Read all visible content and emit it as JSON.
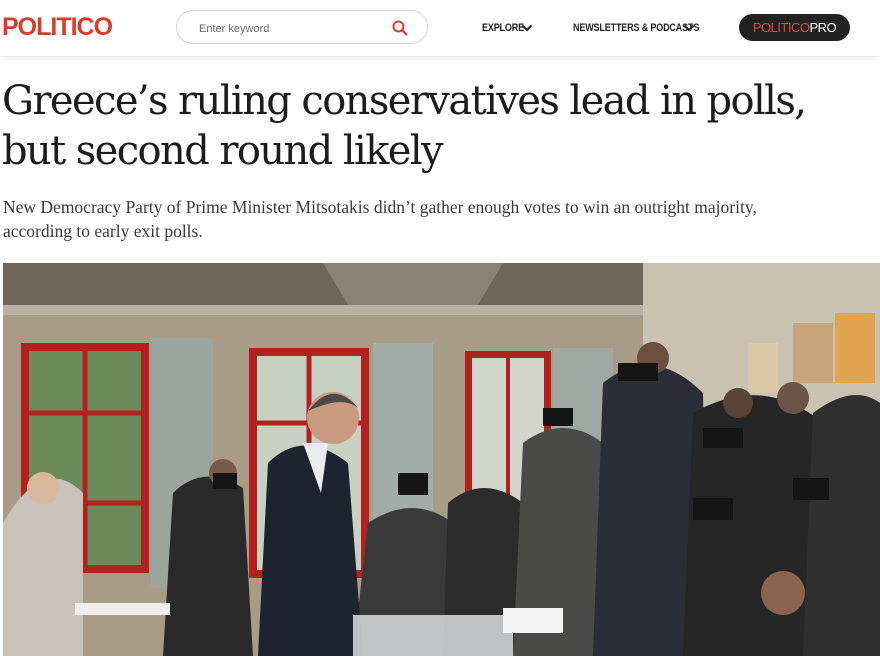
{
  "header": {
    "logo": "POLITICO",
    "search_placeholder": "Enter keyword",
    "nav": [
      {
        "label": "EXPLORE"
      },
      {
        "label": "NEWSLETTERS & PODCASTS"
      }
    ],
    "pro_button": {
      "part1": "POLITICO",
      "part2": "PRO"
    }
  },
  "article": {
    "headline_line1": "Greece’s ruling conservatives lead in polls,",
    "headline_line2": "but second round likely",
    "dek_line1": "New Democracy Party of Prime Minister Mitsotakis didn’t gather enough votes to win an outright majority,",
    "dek_line2": "according to early exit polls."
  },
  "colors": {
    "brand_red": "#dc3b2a",
    "pro_bg": "#222222",
    "headline": "#1c1c1c",
    "dek": "#3a3a3a"
  },
  "icons": [
    "search-icon",
    "chevron-down-icon"
  ]
}
